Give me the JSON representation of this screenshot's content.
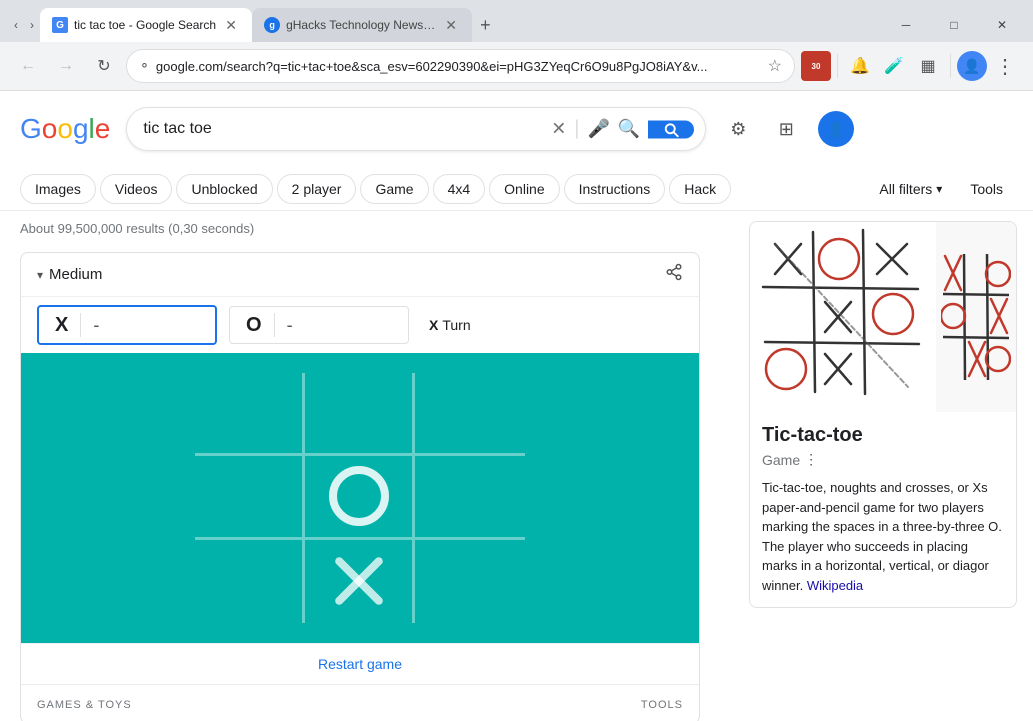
{
  "browser": {
    "tabs": [
      {
        "id": "tab1",
        "favicon": "G",
        "title": "tic tac toe - Google Search",
        "active": true,
        "favicon_color": "#4285f4"
      },
      {
        "id": "tab2",
        "favicon": "g",
        "title": "gHacks Technology News and",
        "active": false,
        "favicon_color": "#1a73e8"
      }
    ],
    "new_tab_label": "+",
    "window_controls": {
      "minimize": "─",
      "maximize": "□",
      "close": "✕"
    },
    "nav": {
      "back": "←",
      "forward": "→",
      "reload": "↻"
    },
    "url": "google.com/search?q=tic+tac+toe&sca_esv=602290390&ei=pHG3ZYeqCr6O9u8PgJO8iAY&v...",
    "bookmark": "☆",
    "toolbar_icons": [
      "🛡",
      "🔔",
      "🧪",
      "⊞"
    ]
  },
  "search": {
    "logo": {
      "G": "#4285f4",
      "o1": "#ea4335",
      "o2": "#fbbc05",
      "g": "#4285f4",
      "l": "#34a853",
      "e": "#ea4335"
    },
    "query": "tic tac toe",
    "clear_icon": "✕",
    "voice_icon": "🎤",
    "lens_icon": "🔍",
    "search_icon": "🔍",
    "filters": [
      "Images",
      "Videos",
      "Unblocked",
      "2 player",
      "Game",
      "4x4",
      "Online",
      "Instructions",
      "Hack"
    ],
    "all_filters": "All filters",
    "tools": "Tools",
    "results_stats": "About 99,500,000 results (0,30 seconds)"
  },
  "game_widget": {
    "collapse_icon": "▾",
    "difficulty": "Medium",
    "share_icon": "⎘",
    "player_x_label": "X",
    "player_x_score": "-",
    "player_o_label": "O",
    "player_o_score": "-",
    "turn_label": "Turn",
    "turn_player": "X",
    "board": [
      "",
      "",
      "",
      "",
      "O",
      "",
      "",
      "X",
      ""
    ],
    "restart_label": "Restart game",
    "section_label": "GAMES & TOYS",
    "section_label2": "TOOLS"
  },
  "knowledge_card": {
    "title": "Tic-tac-toe",
    "subtitle": "Game",
    "more_icon": "⋮",
    "description": "Tic-tac-toe, noughts and crosses, or Xs paper-and-pencil game for two players marking the spaces in a three-by-three O. The player who succeeds in placing marks in a horizontal, vertical, or diagor winner.",
    "wiki_text": "Wikipedia",
    "wiki_link": "#"
  }
}
